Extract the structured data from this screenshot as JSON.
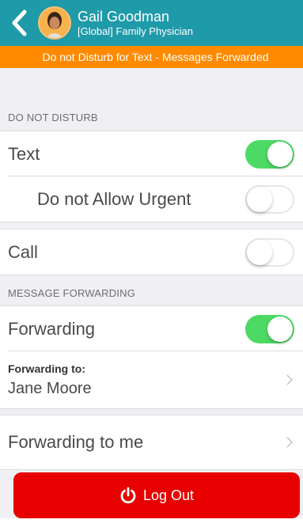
{
  "header": {
    "name": "Gail Goodman",
    "role": "[Global] Family Physician",
    "back_icon": "chevron-left-icon",
    "bg_color": "#1f9aa8"
  },
  "banner": {
    "text": "Do not Disturb for Text - Messages Forwarded",
    "bg_color": "#ff8a00"
  },
  "dnd_section": {
    "title": "DO NOT DISTURB",
    "rows": [
      {
        "label": "Text",
        "toggle": "on"
      },
      {
        "label": "Do not Allow Urgent",
        "toggle": "off"
      }
    ]
  },
  "call_row": {
    "label": "Call",
    "toggle": "off"
  },
  "forwarding_section": {
    "title": "MESSAGE FORWARDING",
    "forwarding_label": "Forwarding",
    "forwarding_toggle": "on",
    "forwarding_to_caption": "Forwarding to:",
    "forwarding_to_name": "Jane Moore"
  },
  "forwarding_to_me": {
    "label": "Forwarding to me"
  },
  "logout": {
    "label": "Log Out",
    "icon": "power-icon",
    "color": "#e60000"
  },
  "colors": {
    "toggle_on": "#4cd964"
  }
}
